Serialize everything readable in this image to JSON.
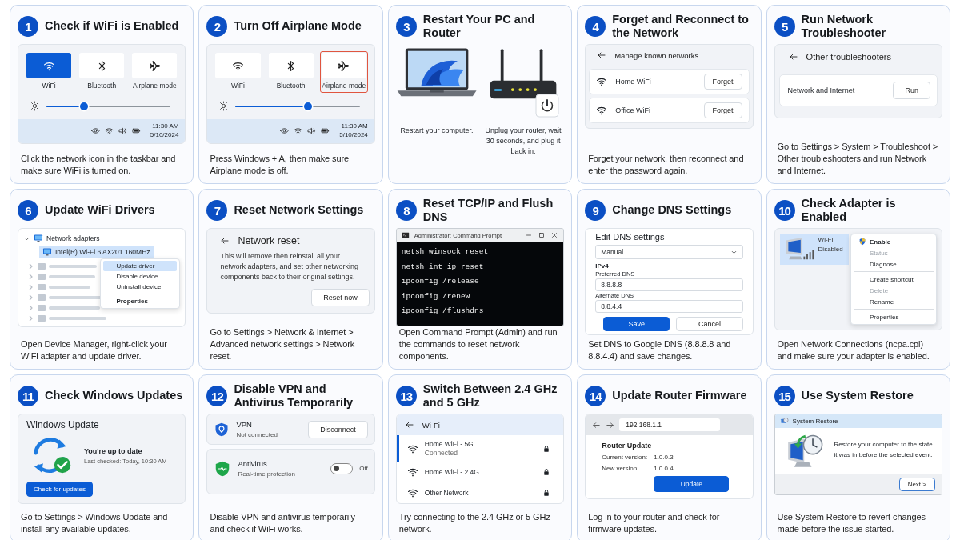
{
  "cards": [
    {
      "number": "1",
      "title": "Check if WiFi is Enabled",
      "kind": "quick_settings",
      "panel": {
        "tiles": [
          {
            "kind": "wifi",
            "label": "WiFi",
            "on": true,
            "highlighted": false
          },
          {
            "kind": "bluetooth",
            "label": "Bluetooth",
            "on": false,
            "highlighted": false
          },
          {
            "kind": "airplane",
            "label": "Airplane mode",
            "on": false,
            "highlighted": false
          }
        ],
        "brightness": {
          "level": 0.3
        },
        "time": "11:30 AM",
        "date": "5/10/2024"
      },
      "caption": "Click the network icon in the taskbar and make sure WiFi is turned on."
    },
    {
      "number": "2",
      "title": "Turn Off Airplane Mode",
      "kind": "quick_settings",
      "panel": {
        "tiles": [
          {
            "kind": "wifi",
            "label": "WiFi",
            "on": false,
            "highlighted": false
          },
          {
            "kind": "bluetooth",
            "label": "Bluetooth",
            "on": false,
            "highlighted": false
          },
          {
            "kind": "airplane",
            "label": "Airplane mode",
            "on": false,
            "highlighted": true
          }
        ],
        "brightness": {
          "level": 0.58
        },
        "time": "11:30 AM",
        "date": "5/10/2024"
      },
      "caption": "Press Windows + A, then make sure Airplane mode is off."
    },
    {
      "number": "3",
      "title": "Restart Your PC and Router",
      "kind": "restart",
      "panel": {
        "items": [
          {
            "kind": "laptop",
            "caption": "Restart your computer."
          },
          {
            "kind": "router",
            "caption": "Unplug your router, wait 30 seconds, and plug it back in."
          }
        ]
      }
    },
    {
      "number": "4",
      "title": "Forget and Reconnect to the Network",
      "kind": "known_networks",
      "panel": {
        "heading": "Manage known networks",
        "networks": [
          {
            "name": "Home WiFi",
            "button": "Forget"
          },
          {
            "name": "Office WiFi",
            "button": "Forget"
          }
        ]
      },
      "caption": "Forget your network, then reconnect and enter the password again."
    },
    {
      "number": "5",
      "title": "Run Network Troubleshooter",
      "kind": "troubleshooter",
      "panel": {
        "heading": "Other troubleshooters",
        "item": "Network and Internet",
        "button": "Run"
      },
      "caption": "Go to Settings > System > Troubleshoot > Other troubleshooters and run Network and Internet."
    },
    {
      "number": "6",
      "title": "Update WiFi Drivers",
      "kind": "device_manager",
      "panel": {
        "category": "Network adapters",
        "adapter": {
          "name": "Intel(R) Wi-Fi 6 AX201 160MHz",
          "selected": true
        },
        "menu": [
          {
            "label": "Update driver",
            "selected": true,
            "bold": false,
            "divider_before": false
          },
          {
            "label": "Disable device",
            "selected": false,
            "bold": false,
            "divider_before": false
          },
          {
            "label": "Uninstall device",
            "selected": false,
            "bold": false,
            "divider_before": false
          },
          {
            "label": "Properties",
            "selected": false,
            "bold": true,
            "divider_before": true
          }
        ]
      },
      "caption": "Open Device Manager, right-click your WiFi adapter and update driver."
    },
    {
      "number": "7",
      "title": "Reset Network Settings",
      "kind": "network_reset",
      "panel": {
        "heading": "Network reset",
        "text": "This will remove then reinstall all your network adapters, and set other networking components back to their original settings.",
        "button": "Reset now"
      },
      "caption": "Go to Settings > Network & Internet > Advanced network settings > Network reset."
    },
    {
      "number": "8",
      "title": "Reset TCP/IP and Flush DNS",
      "kind": "terminal",
      "panel": {
        "title": "Administrator: Command Prompt",
        "lines": [
          "netsh winsock reset",
          "netsh int ip reset",
          "ipconfig /release",
          "ipconfig /renew",
          "ipconfig /flushdns"
        ]
      },
      "caption": "Open Command Prompt (Admin) and run the commands to reset network components."
    },
    {
      "number": "9",
      "title": "Change DNS Settings",
      "kind": "dns",
      "panel": {
        "heading": "Edit DNS settings",
        "mode": "Manual",
        "section": "IPv4",
        "fields": [
          {
            "label": "Preferred DNS",
            "value": "8.8.8.8"
          },
          {
            "label": "Alternate DNS",
            "value": "8.8.4.4"
          }
        ],
        "buttons": [
          {
            "label": "Save",
            "primary": true
          },
          {
            "label": "Cancel",
            "primary": false
          }
        ]
      },
      "caption": "Set DNS to Google DNS (8.8.8.8 and 8.8.4.4) and save changes."
    },
    {
      "number": "10",
      "title": "Check Adapter is Enabled",
      "kind": "adapter_menu",
      "panel": {
        "adapter": {
          "name": "Wi-Fi",
          "status": "Disabled",
          "selected": true
        },
        "menu": [
          {
            "label": "Enable",
            "bold": true,
            "disabled": false,
            "shield": true,
            "divider_before": false
          },
          {
            "label": "Status",
            "bold": false,
            "disabled": true,
            "shield": false,
            "divider_before": false
          },
          {
            "label": "Diagnose",
            "bold": false,
            "disabled": false,
            "shield": false,
            "divider_before": false
          },
          {
            "label": "Create shortcut",
            "bold": false,
            "disabled": false,
            "shield": false,
            "divider_before": true
          },
          {
            "label": "Delete",
            "bold": false,
            "disabled": true,
            "shield": false,
            "divider_before": false
          },
          {
            "label": "Rename",
            "bold": false,
            "disabled": false,
            "shield": false,
            "divider_before": false
          },
          {
            "label": "Properties",
            "bold": false,
            "disabled": false,
            "shield": false,
            "divider_before": true
          }
        ]
      },
      "caption": "Open Network Connections (ncpa.cpl) and make sure your adapter is enabled."
    },
    {
      "number": "11",
      "title": "Check Windows Updates",
      "kind": "windows_update",
      "panel": {
        "heading": "Windows Update",
        "status": "You're up to date",
        "detail": "Last checked: Today, 10:30 AM",
        "button": "Check for updates"
      },
      "caption": "Go to Settings > Windows Update and install any available updates."
    },
    {
      "number": "12",
      "title": "Disable VPN and Antivirus Temporarily",
      "kind": "security",
      "panel": {
        "items": [
          {
            "kind": "vpn",
            "name": "VPN",
            "status": "Not connected",
            "button": "Disconnect"
          },
          {
            "kind": "antivirus",
            "name": "Antivirus",
            "status": "Real-time protection",
            "on": false,
            "state_label": "Off"
          }
        ]
      },
      "caption": "Disable VPN and antivirus temporarily and check if WiFi works."
    },
    {
      "number": "13",
      "title": "Switch Between 2.4 GHz and 5 GHz",
      "kind": "wifi_list",
      "panel": {
        "heading": "Wi-Fi",
        "networks": [
          {
            "name": "Home WiFi - 5G",
            "status": "Connected",
            "selected": true,
            "secured": true
          },
          {
            "name": "Home WiFi - 2.4G",
            "selected": false,
            "secured": true
          },
          {
            "name": "Other Network",
            "selected": false,
            "secured": true
          }
        ]
      },
      "caption": "Try connecting to the 2.4 GHz or 5 GHz network."
    },
    {
      "number": "14",
      "title": "Update Router Firmware",
      "kind": "router_update",
      "panel": {
        "address": "192.168.1.1",
        "heading": "Router Update",
        "rows": [
          {
            "label": "Current version:",
            "value": "1.0.0.3"
          },
          {
            "label": "New version:",
            "value": "1.0.0.4"
          }
        ],
        "button": "Update"
      },
      "caption": "Log in to your router and check for firmware updates."
    },
    {
      "number": "15",
      "title": "Use System Restore",
      "kind": "system_restore",
      "panel": {
        "title": "System Restore",
        "text": "Restore your computer to the state it was in before the selected event.",
        "button": "Next >"
      },
      "caption": "Use System Restore to revert changes made before the issue started."
    }
  ]
}
